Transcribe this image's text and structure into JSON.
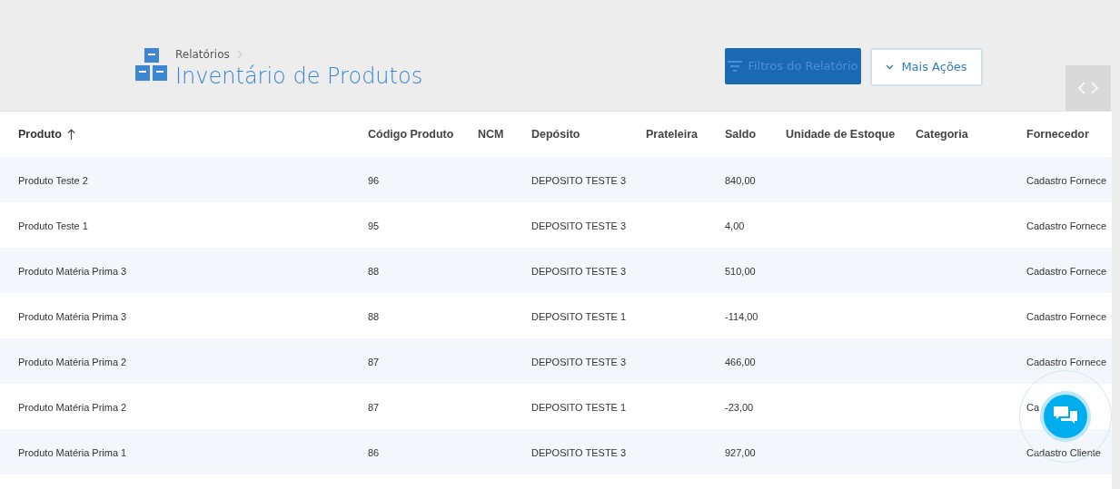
{
  "breadcrumb": "Relatórios",
  "title": "Inventário de Produtos",
  "buttons": [
    {
      "label": "Filtros do Relatório",
      "kind": "primary"
    },
    {
      "label": "Mais Ações",
      "kind": "menu"
    }
  ],
  "columns": [
    {
      "label": "Produto",
      "sorted": true
    },
    {
      "label": "Código Produto",
      "sorted": false
    },
    {
      "label": "NCM",
      "sorted": false
    },
    {
      "label": "Depósito",
      "sorted": false
    },
    {
      "label": "Prateleira",
      "sorted": false
    },
    {
      "label": "Saldo",
      "sorted": false
    },
    {
      "label": "Unidade de Estoque",
      "sorted": false
    },
    {
      "label": "Categoria",
      "sorted": false
    },
    {
      "label": "Fornecedor",
      "sorted": false
    }
  ],
  "rows": [
    [
      "Produto Teste 2",
      "96",
      "",
      "DEPOSITO TESTE 3",
      "",
      "840,00",
      "",
      "",
      "Cadastro Fornece"
    ],
    [
      "Produto Teste 1",
      "95",
      "",
      "DEPOSITO TESTE 3",
      "",
      "4,00",
      "",
      "",
      "Cadastro Fornece"
    ],
    [
      "Produto Matéria Prima 3",
      "88",
      "",
      "DEPOSITO TESTE 3",
      "",
      "510,00",
      "",
      "",
      "Cadastro Fornece"
    ],
    [
      "Produto Matéria Prima 3",
      "88",
      "",
      "DEPOSITO TESTE 1",
      "",
      "-114,00",
      "",
      "",
      "Cadastro Fornece"
    ],
    [
      "Produto Matéria Prima 2",
      "87",
      "",
      "DEPOSITO TESTE 3",
      "",
      "466,00",
      "",
      "",
      "Cadastro Fornece"
    ],
    [
      "Produto Matéria Prima 2",
      "87",
      "",
      "DEPOSITO TESTE 1",
      "",
      "-23,00",
      "",
      "",
      "Ca"
    ],
    [
      "Produto Matéria Prima 1",
      "86",
      "",
      "DEPOSITO TESTE 3",
      "",
      "927,00",
      "",
      "",
      "Cadastro Cliente"
    ]
  ]
}
